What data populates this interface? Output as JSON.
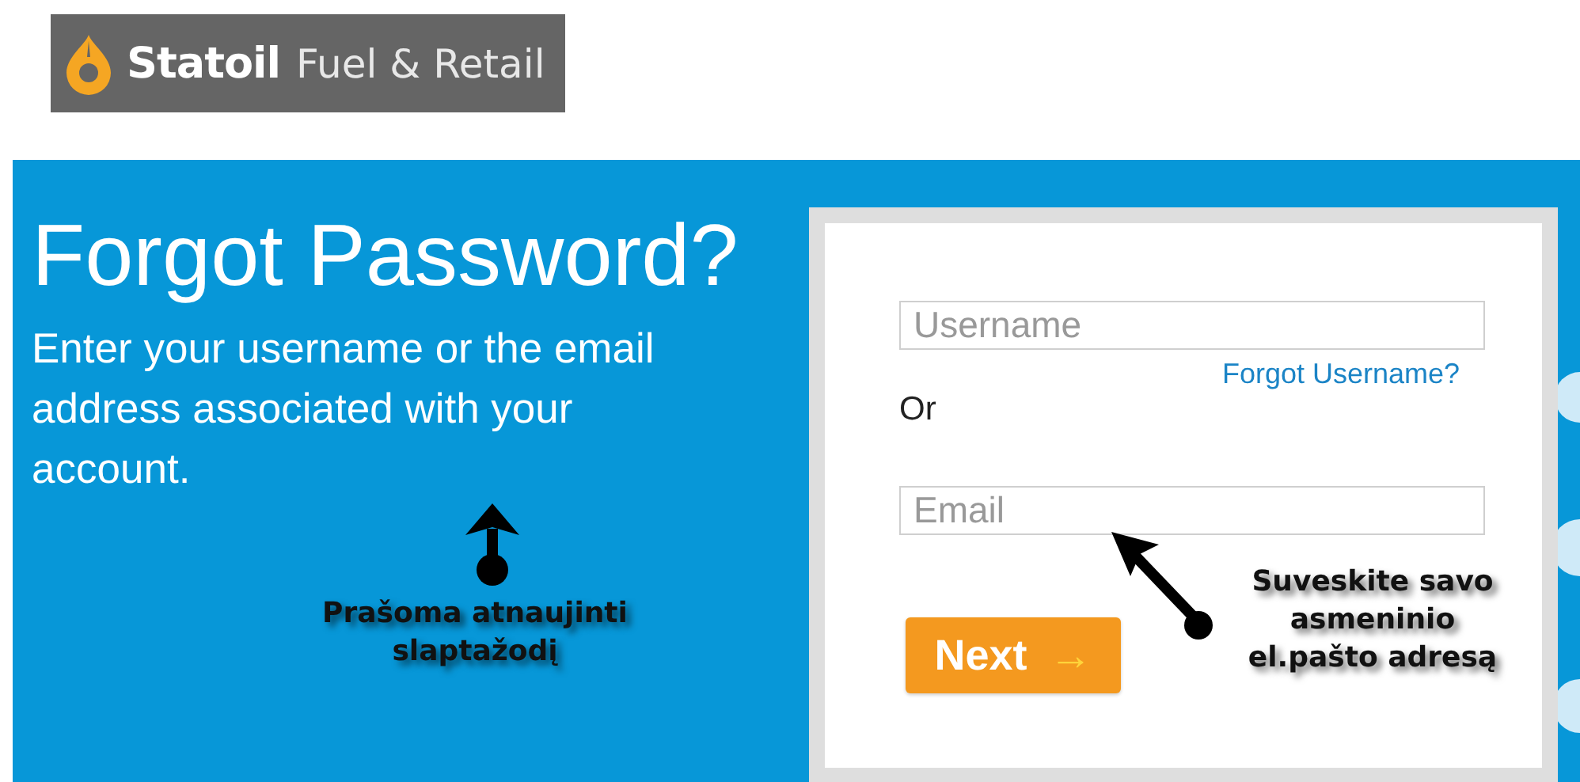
{
  "logo": {
    "brand": "Statoil",
    "tagline": "Fuel & Retail"
  },
  "heading": "Forgot Password?",
  "description": "Enter your username or the email address associated with your account.",
  "form": {
    "username_placeholder": "Username",
    "forgot_username_link": "Forgot Username?",
    "separator": "Or",
    "email_placeholder": "Email",
    "next_button": {
      "label": "Next",
      "icon": "→"
    }
  },
  "annotations": [
    {
      "text": "Prašoma atnaujinti slaptažodį"
    },
    {
      "text": "Suveskite savo asmeninio el.pašto adresą"
    }
  ]
}
